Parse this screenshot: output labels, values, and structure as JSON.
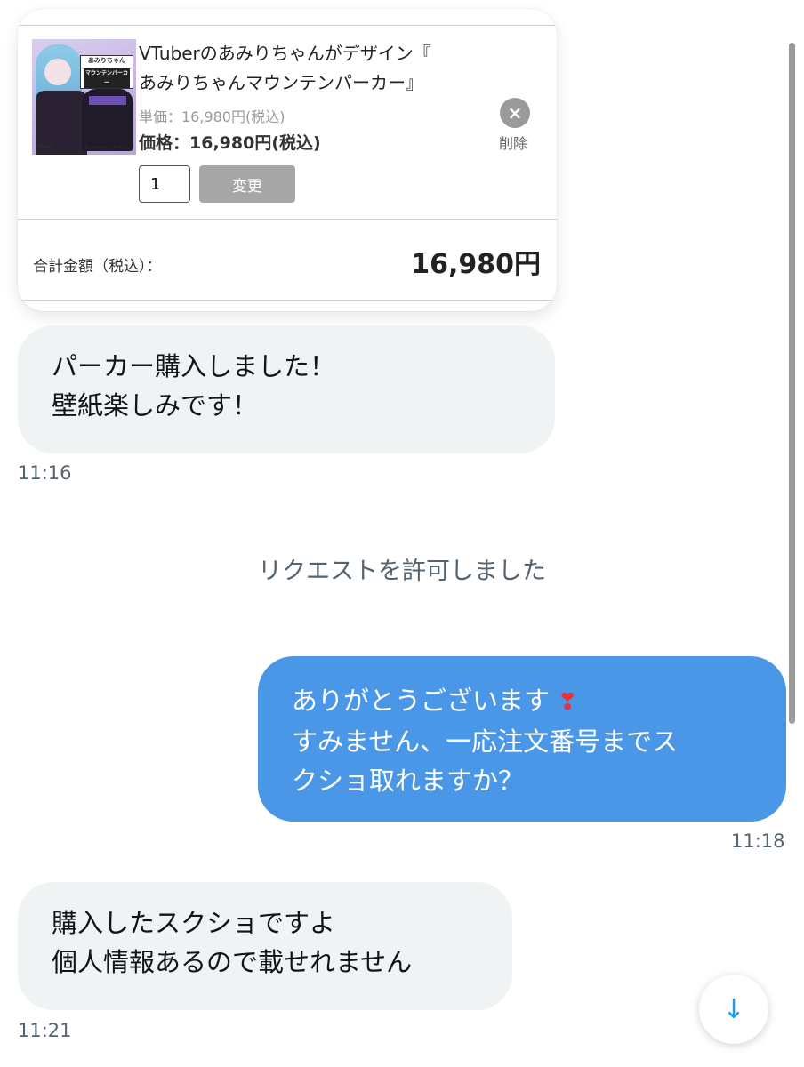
{
  "card": {
    "product_title_line1": "VTuberのあみりちゃんがデザイン『",
    "product_title_line2": "あみりちゃんマウンテンパーカー』",
    "thumb_badge_line1": "あみりちゃん",
    "thumb_badge_line2": "マウンテンパーカー",
    "thumb_bottom_left": "VTuber",
    "thumb_bottom_right": "あみりちゃん デザイン",
    "unit_price": "単価：16,980円(税込)",
    "price": "価格：16,980円(税込)",
    "delete_icon": "×",
    "delete_label": "削除",
    "quantity": "1",
    "change_label": "変更",
    "total_label": "合計金額（税込）：",
    "total_value": "16,980円"
  },
  "messages": [
    {
      "direction": "in",
      "lines": [
        "パーカー購入しました！",
        "壁紙楽しみです！"
      ],
      "time": "11:16"
    },
    {
      "direction": "system",
      "text": "リクエストを許可しました"
    },
    {
      "direction": "out",
      "lines": [
        "ありがとうございます",
        "すみません、一応注文番号までス",
        "クショ取れますか？"
      ],
      "emoji": "❣",
      "time": "11:18"
    },
    {
      "direction": "in",
      "lines": [
        "購入したスクショですよ",
        "個人情報あるので載せれません"
      ],
      "time": "11:21"
    }
  ],
  "scroll_down_icon": "↓"
}
